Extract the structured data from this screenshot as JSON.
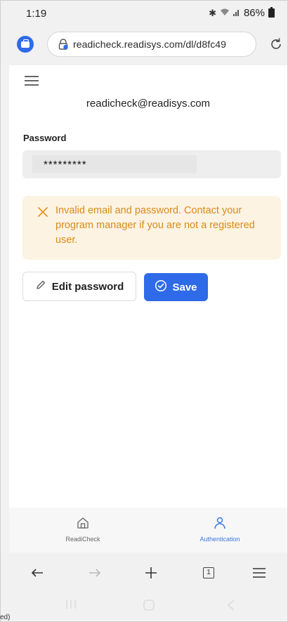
{
  "status_bar": {
    "time": "1:19",
    "battery": "86%",
    "icons": [
      "bluetooth-icon",
      "wifi-icon",
      "signal-icon",
      "battery-icon"
    ]
  },
  "browser": {
    "url": "readicheck.readisys.com/dl/d8fc49",
    "tab_count": "1"
  },
  "page": {
    "email": "readicheck@readisys.com",
    "password_label": "Password",
    "password_value": "*********",
    "alert_message": "Invalid email and password. Contact your program manager if you are not a registered user.",
    "edit_password_label": "Edit password",
    "save_label": "Save"
  },
  "app_nav": {
    "items": [
      {
        "label": "ReadiCheck",
        "icon": "home-icon",
        "active": false
      },
      {
        "label": "Authentication",
        "icon": "user-icon",
        "active": true
      }
    ]
  },
  "bottom_fragment": "ed)",
  "colors": {
    "accent": "#2f6be8",
    "alert_bg": "#fdf3e2",
    "alert_text": "#d78b1a",
    "active_nav": "#3a78e6"
  }
}
